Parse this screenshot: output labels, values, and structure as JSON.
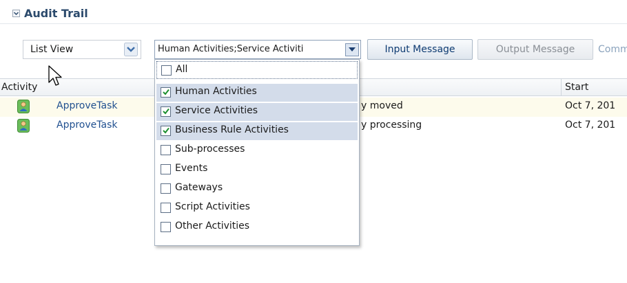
{
  "section": {
    "title": "Audit Trail"
  },
  "toolbar": {
    "view_select": "List View",
    "filter_select": "Human Activities;Service Activiti",
    "input_message": "Input Message",
    "output_message": "Output Message",
    "comm_link": "Comm"
  },
  "table": {
    "headers": {
      "activity": "Activity",
      "start": "Start"
    },
    "rows": [
      {
        "task": "ApproveTask",
        "description": "y moved",
        "start": "Oct 7, 201"
      },
      {
        "task": "ApproveTask",
        "description": "y processing",
        "start": "Oct 7, 201"
      }
    ]
  },
  "filter_options": [
    {
      "label": "All",
      "checked": false
    },
    {
      "label": "Human Activities",
      "checked": true
    },
    {
      "label": "Service Activities",
      "checked": true
    },
    {
      "label": "Business Rule Activities",
      "checked": true
    },
    {
      "label": "Sub-processes",
      "checked": false
    },
    {
      "label": "Events",
      "checked": false
    },
    {
      "label": "Gateways",
      "checked": false
    },
    {
      "label": "Script Activities",
      "checked": false
    },
    {
      "label": "Other Activities",
      "checked": false
    }
  ],
  "colors": {
    "accent": "#2b4a6c",
    "selection": "#d3dcea",
    "link": "#1f4f8f",
    "check": "#1c8f2e"
  }
}
